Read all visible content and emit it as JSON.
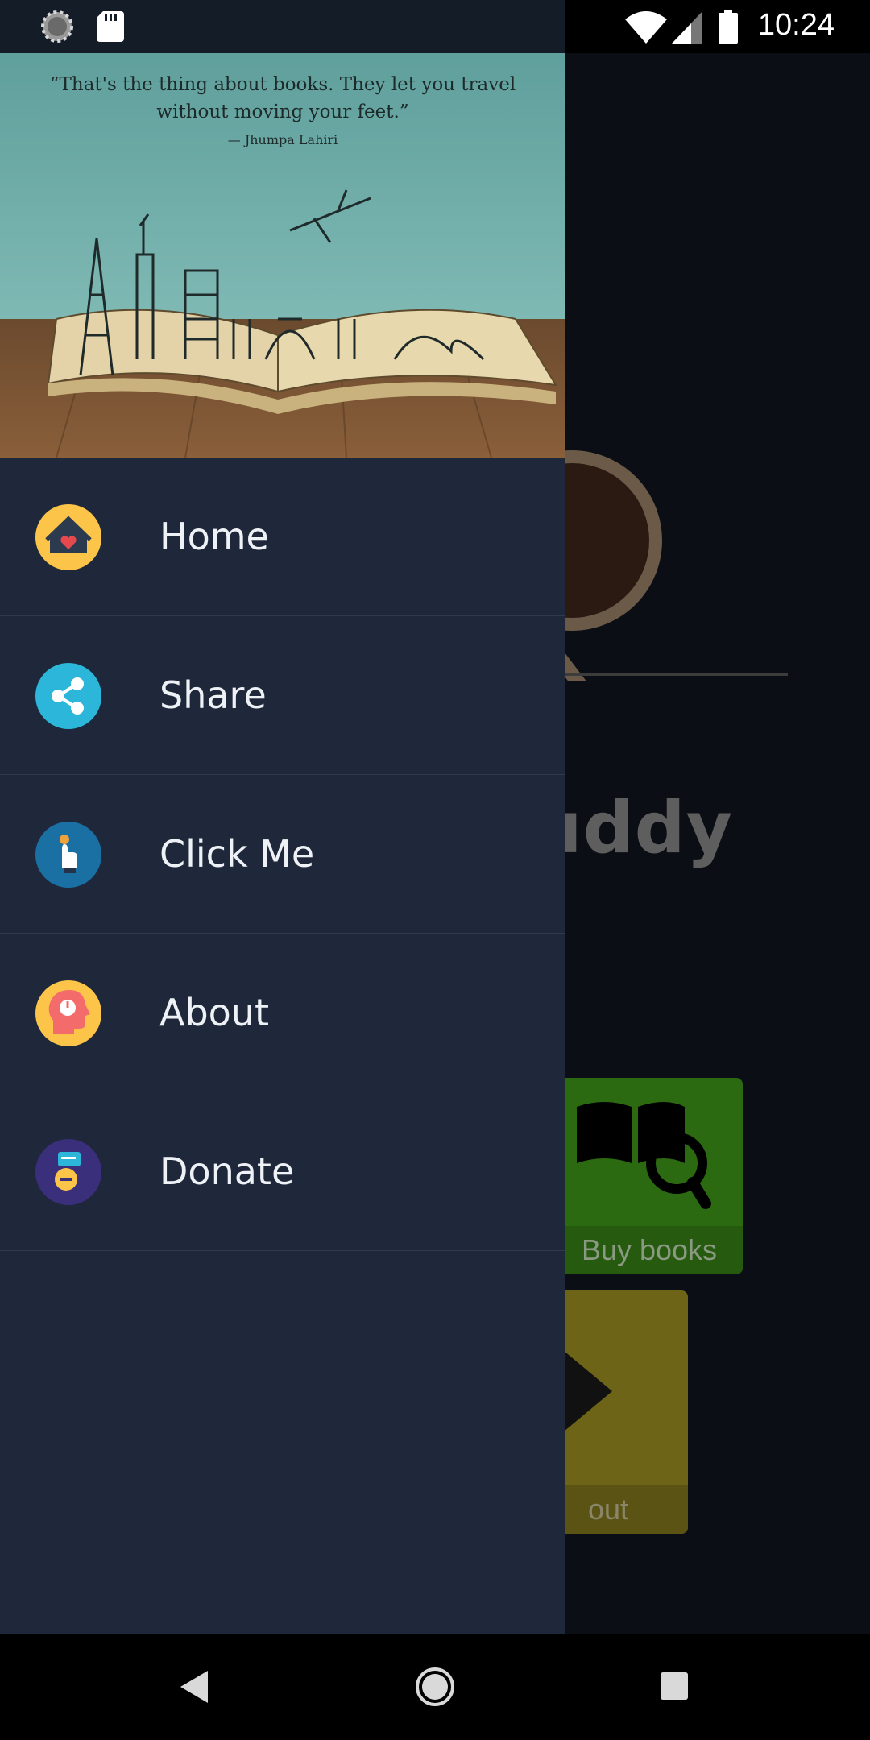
{
  "status_bar": {
    "time": "10:24",
    "left_icons": [
      "loading-spinner-icon",
      "sd-card-icon"
    ],
    "right_icons": [
      "wifi-icon",
      "signal-icon",
      "battery-icon"
    ]
  },
  "drawer": {
    "header_quote": "“That's the thing about books. They let you travel without moving your feet.”",
    "header_quote_line1": "“That's the thing about books. They let you travel",
    "header_quote_line2": "without moving your feet.”",
    "header_author": "— Jhumpa Lahiri",
    "items": [
      {
        "label": "Home",
        "icon": "home-heart-icon",
        "color": "#fcc54a"
      },
      {
        "label": "Share",
        "icon": "share-icon",
        "color": "#2cb6d9"
      },
      {
        "label": "Click Me",
        "icon": "tap-hand-icon",
        "color": "#1a6fa3"
      },
      {
        "label": "About",
        "icon": "head-profile-icon",
        "color": "#fcc54a"
      },
      {
        "label": "Donate",
        "icon": "donate-medal-icon",
        "color": "#3a2f7a"
      }
    ]
  },
  "background_app": {
    "title_fragment": "uddy",
    "tiles": [
      {
        "label": "Buy books",
        "color": "#2c6a12"
      },
      {
        "label": "out",
        "color": "#6e6418"
      }
    ]
  },
  "navigation_bar": {
    "buttons": [
      "back-icon",
      "home-icon",
      "recents-icon"
    ]
  }
}
